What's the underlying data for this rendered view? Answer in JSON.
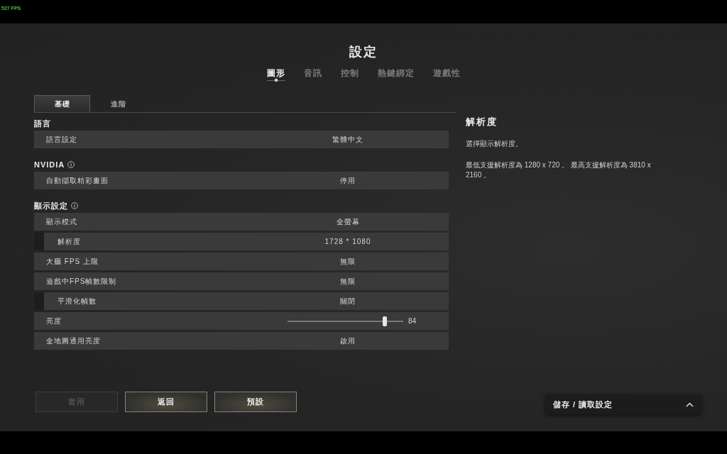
{
  "fps_counter": "527 FPS",
  "title": "設定",
  "tabs": [
    {
      "label": "圖形",
      "selected": true
    },
    {
      "label": "音訊",
      "selected": false
    },
    {
      "label": "控制",
      "selected": false
    },
    {
      "label": "熱鍵綁定",
      "selected": false
    },
    {
      "label": "遊戲性",
      "selected": false
    }
  ],
  "subtabs": [
    {
      "label": "基礎",
      "selected": true
    },
    {
      "label": "進階",
      "selected": false
    }
  ],
  "sections": [
    {
      "heading": "語言",
      "info_icon": false,
      "rows": [
        {
          "kind": "option",
          "label": "語言設定",
          "value": "繁體中文"
        }
      ]
    },
    {
      "heading": "NVIDIA",
      "info_icon": true,
      "rows": [
        {
          "kind": "option",
          "label": "自動擷取精彩畫面",
          "value": "停用"
        }
      ]
    },
    {
      "heading": "顯示設定",
      "info_icon": true,
      "rows": [
        {
          "kind": "option",
          "label": "顯示模式",
          "value": "全螢幕",
          "children": [
            {
              "kind": "option",
              "label": "解析度",
              "value": "1728 * 1080"
            }
          ]
        },
        {
          "kind": "option",
          "label": "大廳 FPS 上限",
          "value": "無限"
        },
        {
          "kind": "option",
          "label": "遊戲中FPS幀數限制",
          "value": "無限",
          "children": [
            {
              "kind": "option",
              "label": "平滑化幀數",
              "value": "關閉"
            }
          ]
        },
        {
          "kind": "slider",
          "label": "亮度",
          "level": 0.84,
          "reading": "84"
        },
        {
          "kind": "option",
          "label": "全地圖通用亮度",
          "value": "啟用"
        }
      ]
    }
  ],
  "details": {
    "title": "解析度",
    "paragraphs": [
      "選擇顯示解析度。",
      "最低支援解析度為 1280 x 720 。 最高支援解析度為 3810 x 2160 。"
    ]
  },
  "buttons": [
    {
      "label": "套用",
      "disabled": true
    },
    {
      "label": "返回",
      "disabled": false
    },
    {
      "label": "預設",
      "disabled": false
    }
  ],
  "save_load": {
    "label": "儲存 / 讀取設定"
  }
}
